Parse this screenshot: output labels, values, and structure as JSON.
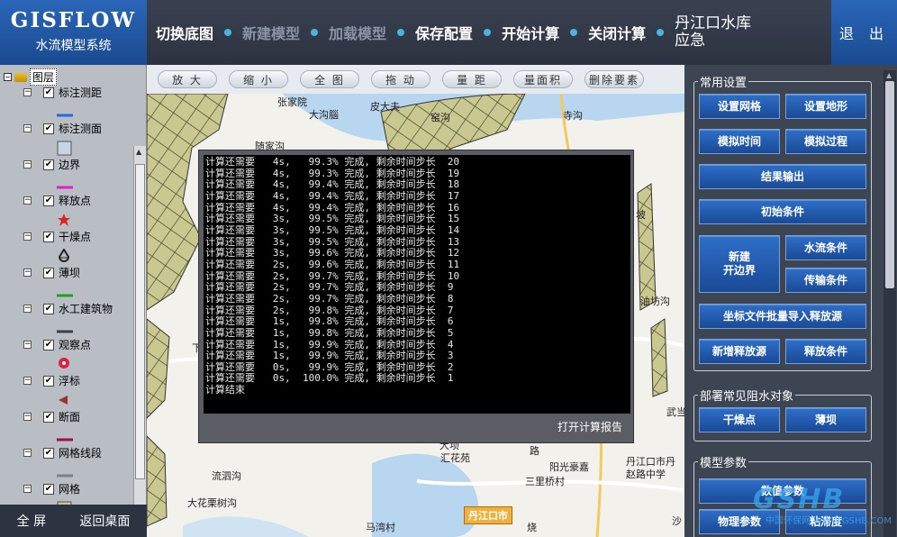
{
  "app": {
    "title": "GISFLOW",
    "subtitle": "水流模型系统"
  },
  "topnav": {
    "items": [
      {
        "label": "切换底图",
        "enabled": true
      },
      {
        "label": "新建模型",
        "enabled": false
      },
      {
        "label": "加载模型",
        "enabled": false
      },
      {
        "label": "保存配置",
        "enabled": true
      },
      {
        "label": "开始计算",
        "enabled": true
      },
      {
        "label": "关闭计算",
        "enabled": true
      },
      {
        "label": "丹江口水库应急",
        "enabled": true
      }
    ],
    "exit_label": "退 出"
  },
  "layers": {
    "root_label": "图层",
    "items": [
      {
        "label": "标注测距",
        "checked": true,
        "symbol": "line",
        "color": "#2a6ad8"
      },
      {
        "label": "标注测面",
        "checked": true,
        "symbol": "square",
        "color": "#c8d4e4"
      },
      {
        "label": "边界",
        "checked": true,
        "symbol": "line",
        "color": "#e020d0"
      },
      {
        "label": "释放点",
        "checked": true,
        "symbol": "star",
        "color": "#e02020"
      },
      {
        "label": "干燥点",
        "checked": true,
        "symbol": "drop",
        "color": "#222222"
      },
      {
        "label": "薄坝",
        "checked": true,
        "symbol": "line",
        "color": "#20a020"
      },
      {
        "label": "水工建筑物",
        "checked": true,
        "symbol": "line",
        "color": "#404040"
      },
      {
        "label": "观察点",
        "checked": true,
        "symbol": "pin",
        "color": "#e02040"
      },
      {
        "label": "浮标",
        "checked": true,
        "symbol": "triangle",
        "color": "#a03030"
      },
      {
        "label": "断面",
        "checked": true,
        "symbol": "line",
        "color": "#a01040"
      },
      {
        "label": "网格线段",
        "checked": true,
        "symbol": "line",
        "color": "#808080"
      },
      {
        "label": "网格",
        "checked": true,
        "symbol": "square",
        "color": "#c8c890"
      }
    ]
  },
  "bottom_left": {
    "fullscreen": "全 屏",
    "back_desktop": "返回桌面"
  },
  "map_toolbar": {
    "tools": [
      "放 大",
      "缩 小",
      "全 图",
      "拖 动",
      "量 距",
      "量面积",
      "删除要素"
    ]
  },
  "map_labels": {
    "p1": "张家院",
    "p2": "大沟腦",
    "p3": "皮大夫",
    "p4": "窑沟",
    "p5": "寺沟",
    "p6": "随家沟",
    "p7": "坡",
    "p8": "油坊沟",
    "p9": "下",
    "p10": "武当",
    "p11": "汇花苑",
    "p12": "大坝",
    "p13": "路",
    "p14": "阳光豪嘉",
    "p15": "丹江口市丹赵路中学",
    "p16": "流泗沟",
    "p17": "三里桥村",
    "p18": "大花栗树沟",
    "p19": "马湾村",
    "p20": "烧",
    "box": "丹江口市",
    "p21": "沙"
  },
  "console": {
    "lines": [
      "计算还需要   4s,   99.3% 完成, 剩余时间步长  20",
      "计算还需要   4s,   99.3% 完成, 剩余时间步长  19",
      "计算还需要   4s,   99.4% 完成, 剩余时间步长  18",
      "计算还需要   4s,   99.4% 完成, 剩余时间步长  17",
      "计算还需要   4s,   99.4% 完成, 剩余时间步长  16",
      "计算还需要   3s,   99.5% 完成, 剩余时间步长  15",
      "计算还需要   3s,   99.5% 完成, 剩余时间步长  14",
      "计算还需要   3s,   99.5% 完成, 剩余时间步长  13",
      "计算还需要   3s,   99.6% 完成, 剩余时间步长  12",
      "计算还需要   2s,   99.6% 完成, 剩余时间步长  11",
      "计算还需要   2s,   99.7% 完成, 剩余时间步长  10",
      "计算还需要   2s,   99.7% 完成, 剩余时间步长  9",
      "计算还需要   2s,   99.7% 完成, 剩余时间步长  8",
      "计算还需要   2s,   99.8% 完成, 剩余时间步长  7",
      "计算还需要   1s,   99.8% 完成, 剩余时间步长  6",
      "计算还需要   1s,   99.8% 完成, 剩余时间步长  5",
      "计算还需要   1s,   99.9% 完成, 剩余时间步长  4",
      "计算还需要   1s,   99.9% 完成, 剩余时间步长  3",
      "计算还需要   0s,   99.9% 完成, 剩余时间步长  2",
      "计算还需要   0s,  100.0% 完成, 剩余时间步长  1",
      "计算结束"
    ],
    "report_button": "打开计算报告"
  },
  "right_panel": {
    "common_settings": {
      "title": "常用设置",
      "buttons": {
        "set_grid": "设置网格",
        "set_terrain": "设置地形",
        "sim_time": "模拟时间",
        "sim_process": "模拟过程",
        "result_output": "结果输出",
        "initial_conditions": "初始条件",
        "new_boundary": "新建\n开边界",
        "flow_conditions": "水流条件",
        "transport_conditions": "传输条件",
        "batch_import": "坐标文件批量导入释放源",
        "add_release": "新增释放源",
        "release_conditions": "释放条件"
      }
    },
    "deploy": {
      "title": "部署常见阻水对象",
      "buttons": {
        "dry_point": "干燥点",
        "thin_dam": "薄坝"
      }
    },
    "model_params": {
      "title": "模型参数",
      "buttons": {
        "numeric_params": "数值参数",
        "physical_params": "物理参数",
        "viscosity": "粘滞度"
      }
    }
  },
  "watermark": {
    "logo": "GSHB",
    "site": "中国环保网 WWW.GSHB.COM"
  },
  "colors": {
    "header_blue": "#1a4a90",
    "button_blue": "#1a4a96",
    "nav_dot": "#48b4e0",
    "grid_fill": "#c8c890"
  }
}
